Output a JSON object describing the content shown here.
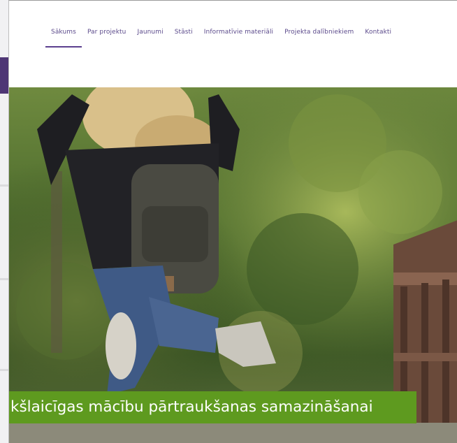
{
  "nav": {
    "items": [
      {
        "label": "Sākums",
        "active": true
      },
      {
        "label": "Par projektu",
        "active": false
      },
      {
        "label": "Jaunumi",
        "active": false
      },
      {
        "label": "Stāsti",
        "active": false
      },
      {
        "label": "Informatīvie materiāli",
        "active": false
      },
      {
        "label": "Projekta dalībniekiem",
        "active": false
      },
      {
        "label": "Kontakti",
        "active": false
      }
    ]
  },
  "hero": {
    "caption": "kšlaicīgas mācību pārtraukšanas samazināšanai"
  },
  "colors": {
    "nav_text": "#5b4a8b",
    "nav_active_underline": "#5b3f8f",
    "caption_bg": "#5e9a1f",
    "sidebar_purple": "#4e3675"
  }
}
